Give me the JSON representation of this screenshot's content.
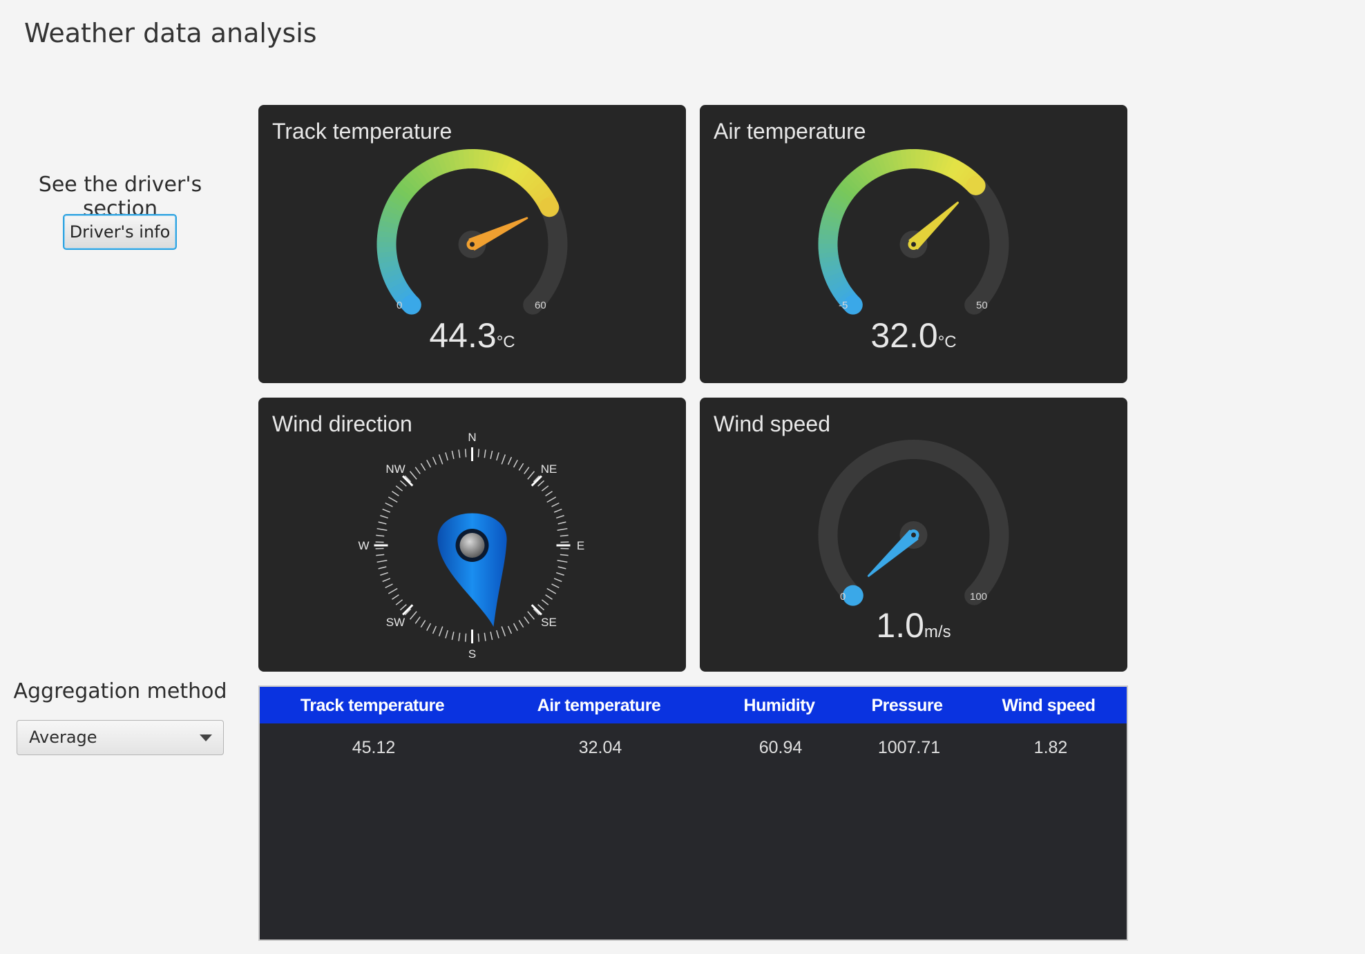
{
  "window": {
    "title": "Weather data analysis"
  },
  "sidebar": {
    "driver_label": "See the driver's section",
    "driver_button": "Driver's info",
    "aggregation_label": "Aggregation method",
    "aggregation_value": "Average"
  },
  "tiles": {
    "track": {
      "title": "Track temperature",
      "value": "44.3",
      "unit": "°C",
      "min": "0",
      "max": "60",
      "value_num": 44.3,
      "min_num": 0,
      "max_num": 60,
      "accent": "#f0a030"
    },
    "air": {
      "title": "Air temperature",
      "value": "32.0",
      "unit": "°C",
      "min": "-5",
      "max": "50",
      "value_num": 32.0,
      "min_num": -5,
      "max_num": 50,
      "accent": "#e4d23a"
    },
    "wind_dir": {
      "title": "Wind direction",
      "cardinals": [
        "N",
        "NE",
        "E",
        "SE",
        "S",
        "SW",
        "W",
        "NW"
      ],
      "heading_deg": 180,
      "accent": "#1a7be0"
    },
    "wind_speed": {
      "title": "Wind speed",
      "value": "1.0",
      "unit": "m/s",
      "min": "0",
      "max": "100",
      "value_num": 1.0,
      "min_num": 0,
      "max_num": 100,
      "accent": "#3aa8e8"
    }
  },
  "table": {
    "columns": [
      "Track temperature",
      "Air temperature",
      "Humidity",
      "Pressure",
      "Wind speed"
    ],
    "rows": [
      [
        "45.12",
        "32.04",
        "60.94",
        "1007.71",
        "1.82"
      ]
    ],
    "header_color": "#0a33e0"
  }
}
